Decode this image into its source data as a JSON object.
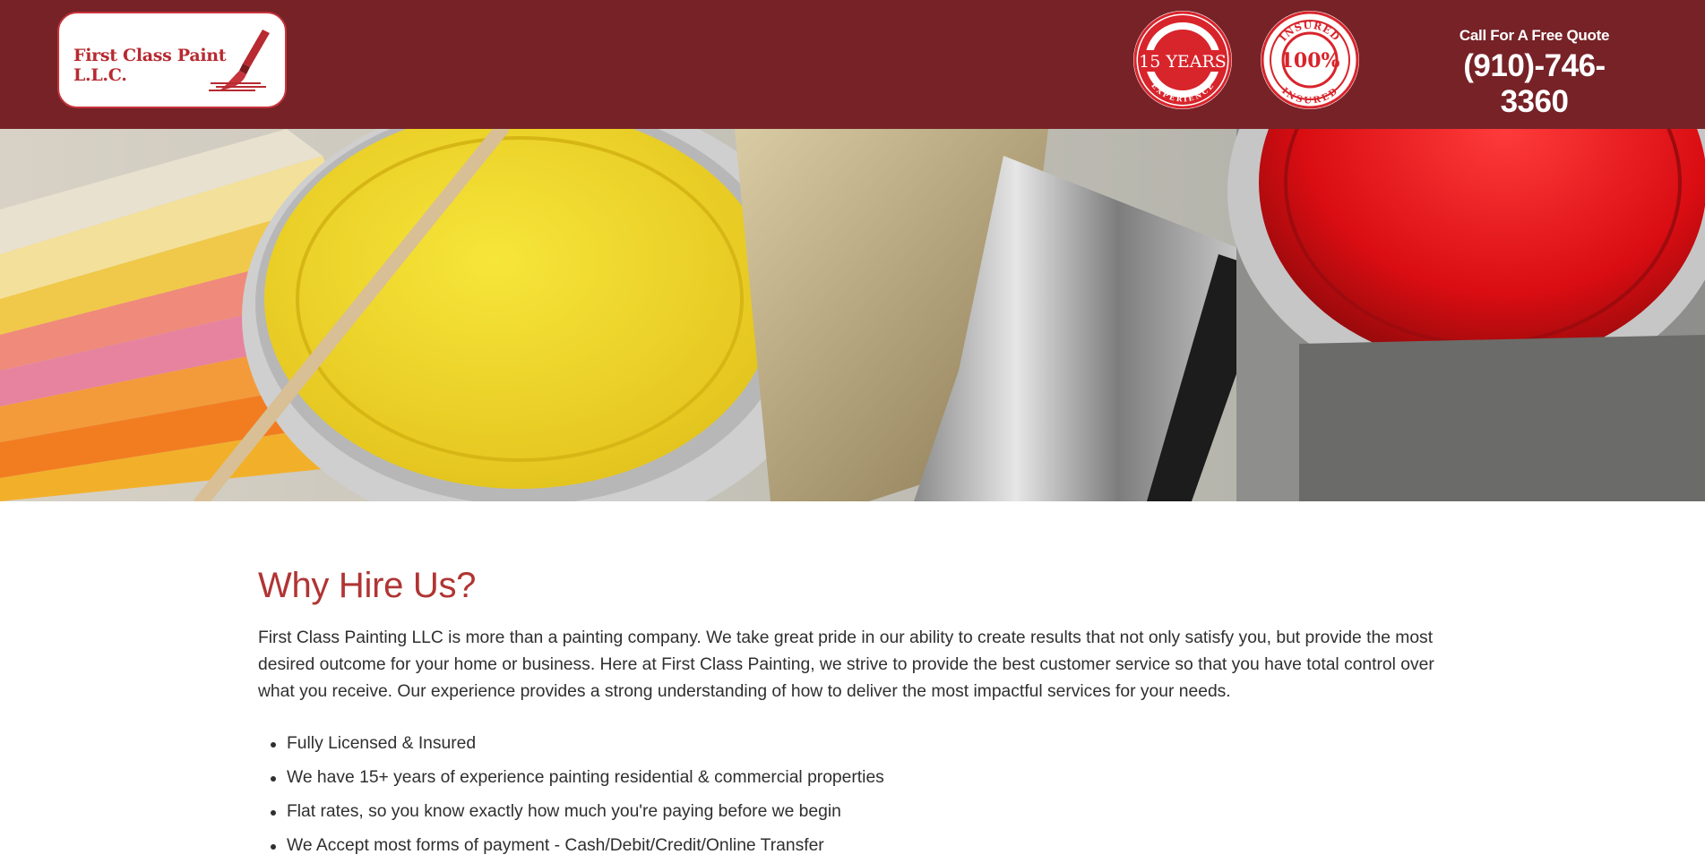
{
  "header": {
    "logo_text": "First Class Paint L.L.C.",
    "badges": [
      {
        "name": "experience-badge",
        "top_text": "EXPERIENCE",
        "main_text": "15 YEARS",
        "bottom_text": "EXPERIENCE"
      },
      {
        "name": "insured-badge",
        "top_text": "INSURED",
        "main_text": "100%",
        "bottom_text": "INSURED"
      }
    ],
    "quote_label": "Call For A Free Quote",
    "phone": "(910)-746-3360"
  },
  "hero": {
    "icon": "paint-cans-image"
  },
  "main": {
    "heading": "Why Hire Us?",
    "intro": "First Class Painting LLC is more than a painting company. We take great pride in our ability to create results that not only satisfy you, but provide the most desired outcome for your home or business. Here at First Class Painting, we strive to provide the best customer service so that you have total control over what you receive. Our experience provides a strong understanding of how to deliver the most impactful services for your needs.",
    "bullets": [
      "Fully Licensed & Insured",
      "We have 15+ years of experience painting residential & commercial properties",
      "Flat rates, so you know exactly how much you're paying before we begin",
      "We Accept most forms of payment - Cash/Debit/Credit/Online Transfer"
    ]
  },
  "colors": {
    "header_bg": "#762227",
    "accent": "#b03534",
    "badge_red": "#d8242b"
  }
}
